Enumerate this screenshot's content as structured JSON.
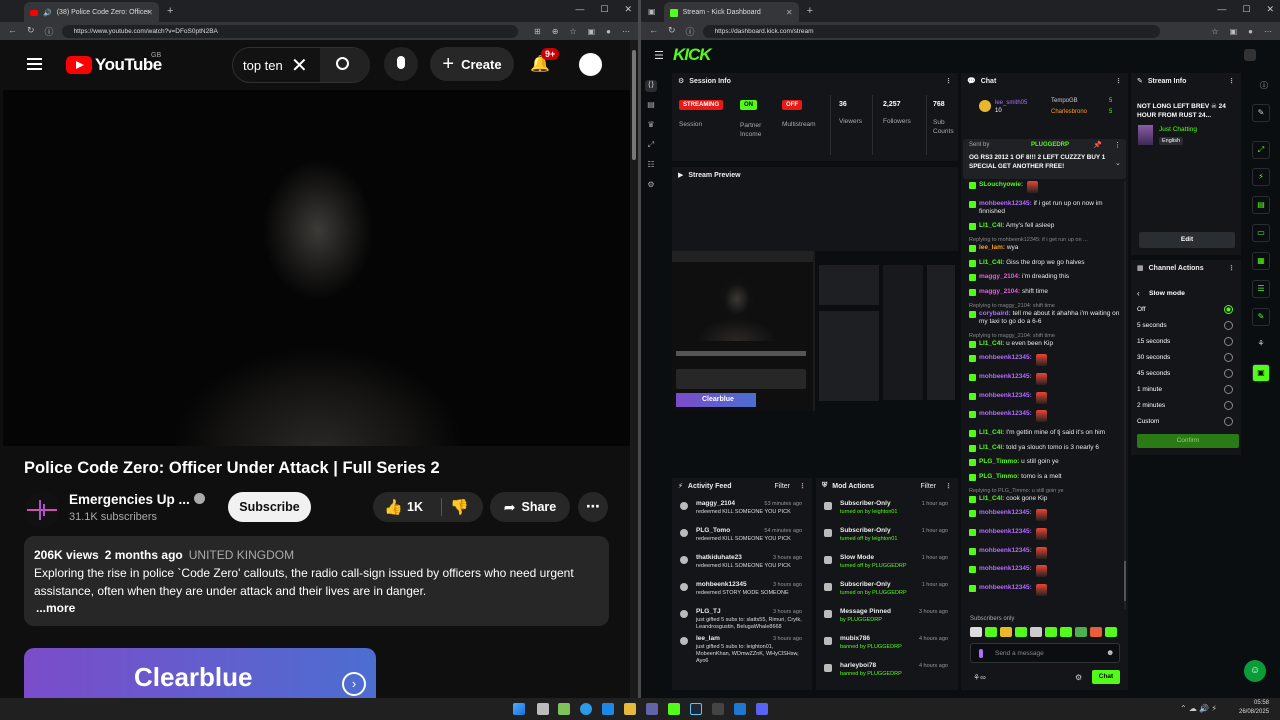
{
  "youtube_window": {
    "tab_title": "(38) Police Code Zero: Officer",
    "url": "https://www.youtube.com/watch?v=DFoS0ptN2BA",
    "logo_text": "YouTube",
    "region": "GB",
    "search_value": "top ten",
    "create_label": "Create",
    "notif_count": "9+",
    "video_title": "Police Code Zero: Officer Under Attack | Full Series 2",
    "channel_name": "Emergencies Up ...",
    "subscribers": "31.1K subscribers",
    "subscribe_label": "Subscribe",
    "likes": "1K",
    "share_label": "Share",
    "views": "206K views",
    "age": "2 months ago",
    "country": "UNITED KINGDOM",
    "desc_line1": "Exploring the rise in police `Code Zero' callouts, the radio call-sign issued by officers who need urgent",
    "desc_line2": "assistance, often when they are under attack and their lives are in danger.",
    "more_label": "...more",
    "ad_text": "Clearblue"
  },
  "kick_window": {
    "tab_title": "Stream - Kick Dashboard",
    "url": "https://dashboard.kick.com/stream",
    "logo": "KICK",
    "session": {
      "header": "Session Info",
      "streaming": "STREAMING",
      "session_label": "Session",
      "on": "ON",
      "partner_label": "Partner Income",
      "off": "OFF",
      "multistream_label": "Multistream",
      "viewers": "36",
      "viewers_label": "Viewers",
      "followers": "2,257",
      "followers_label": "Followers",
      "subs": "768",
      "subs_label": "Sub Counts"
    },
    "preview_header": "Stream Preview",
    "preview_ad": "Clearblue",
    "activity": {
      "header": "Activity Feed",
      "filter": "Filter",
      "rows": [
        {
          "name": "maggy_2104",
          "time": "53 minutes ago",
          "sub": "redeemed KILL SOMEONE YOU PICK"
        },
        {
          "name": "PLG_Tomo",
          "time": "54 minutes ago",
          "sub": "redeemed KILL SOMEONE YOU PICK"
        },
        {
          "name": "thatkiduhate23",
          "time": "3 hours ago",
          "sub": "redeemed KILL SOMEONE YOU PICK"
        },
        {
          "name": "mohbeenk12345",
          "time": "3 hours ago",
          "sub": "redeemed STORY MODE SOMEONE"
        },
        {
          "name": "PLG_TJ",
          "time": "3 hours ago",
          "sub": "just gifted 5 subs to: slatts55, Rimuri, Crytk, Leandrosgustin, BelugaWhale8668"
        },
        {
          "name": "lee_lam",
          "time": "3 hours ago",
          "sub": "just gifted 5 subs to: leighton01, MobeenKhan, WDmwZZnK, WHyClSHsw, Ayo6"
        }
      ]
    },
    "mod": {
      "header": "Mod Actions",
      "filter": "Filter",
      "rows": [
        {
          "name": "Subscriber-Only",
          "time": "1 hour ago",
          "sub": "turned on by leighton01"
        },
        {
          "name": "Subscriber-Only",
          "time": "1 hour ago",
          "sub": "turned off by leighton01"
        },
        {
          "name": "Slow Mode",
          "time": "1 hour ago",
          "sub": "turned off by PLUGGEDRP"
        },
        {
          "name": "Subscriber-Only",
          "time": "1 hour ago",
          "sub": "turned on by PLUGGEDRP"
        },
        {
          "name": "Message Pinned",
          "time": "3 hours ago",
          "sub": "by PLUGGEDRP"
        },
        {
          "name": "mubix786",
          "time": "4 hours ago",
          "sub": "banned by PLUGGEDRP"
        },
        {
          "name": "harleyboi78",
          "time": "4 hours ago",
          "sub": "banned by PLUGGEDRP"
        }
      ]
    },
    "chat": {
      "header": "Chat",
      "top_user": "lee_smith05",
      "top_count": "10",
      "top2": "TempoGB",
      "top2_count": "5",
      "top3": "Charlesbrono",
      "top3_count": "5",
      "pinned_by": "Sent by",
      "pinned_user": "PLUGGEDRP",
      "pinned_text": "OG RS3 2012 1 OF 8!!! 2 LEFT CUZZZY BUY 1 SPECIAL GET ANOTHER FREE!",
      "lines": [
        {
          "reply": "",
          "user": "SLouchyowie:",
          "color": "#53fc18",
          "text": ""
        },
        {
          "reply": "",
          "user": "mohbeenk12345:",
          "color": "#b36cff",
          "text": "if i get run up on now im finnished"
        },
        {
          "reply": "",
          "user": "LI1_C4l:",
          "color": "#53fc18",
          "text": "Amy's fell asleep"
        },
        {
          "reply": "Replying to mohbeenk12345: if i get run up on ...",
          "user": "lee_lam:",
          "color": "#ff9f1c",
          "text": "wya"
        },
        {
          "reply": "",
          "user": "LI1_C4l:",
          "color": "#53fc18",
          "text": "Giss the drop we go halves"
        },
        {
          "reply": "",
          "user": "maggy_2104:",
          "color": "#e85dd9",
          "text": "i'm dreading this"
        },
        {
          "reply": "",
          "user": "maggy_2104:",
          "color": "#e85dd9",
          "text": "shift time"
        },
        {
          "reply": "Replying to maggy_2104: shift time",
          "user": "corybaird:",
          "color": "#b36cff",
          "text": "tell me about it ahahha i'm waiting on my taxi to go do a 6-6"
        },
        {
          "reply": "Replying to maggy_2104: shift time",
          "user": "LI1_C4l:",
          "color": "#53fc18",
          "text": "u even been Kip"
        },
        {
          "reply": "",
          "user": "mohbeenk12345:",
          "color": "#b36cff",
          "text": ""
        },
        {
          "reply": "",
          "user": "mohbeenk12345:",
          "color": "#b36cff",
          "text": ""
        },
        {
          "reply": "",
          "user": "mohbeenk12345:",
          "color": "#b36cff",
          "text": ""
        },
        {
          "reply": "",
          "user": "mohbeenk12345:",
          "color": "#b36cff",
          "text": ""
        },
        {
          "reply": "",
          "user": "LI1_C4l:",
          "color": "#53fc18",
          "text": "I'm gettin mine of tj said it's on him"
        },
        {
          "reply": "",
          "user": "LI1_C4l:",
          "color": "#53fc18",
          "text": "told ya slouch tomo is 3 nearly 6"
        },
        {
          "reply": "",
          "user": "PLG_Timmo:",
          "color": "#53fc18",
          "text": "u still goin ye"
        },
        {
          "reply": "",
          "user": "PLG_Timmo:",
          "color": "#53fc18",
          "text": "tomo is a melt"
        },
        {
          "reply": "Replying to PLG_Timmo: u still goin ye",
          "user": "LI1_C4l:",
          "color": "#53fc18",
          "text": "cook gone Kip"
        },
        {
          "reply": "",
          "user": "mohbeenk12345:",
          "color": "#b36cff",
          "text": ""
        },
        {
          "reply": "",
          "user": "mohbeenk12345:",
          "color": "#b36cff",
          "text": ""
        },
        {
          "reply": "",
          "user": "mohbeenk12345:",
          "color": "#b36cff",
          "text": ""
        },
        {
          "reply": "",
          "user": "mohbeenk12345:",
          "color": "#b36cff",
          "text": ""
        },
        {
          "reply": "",
          "user": "mohbeenk12345:",
          "color": "#b36cff",
          "text": ""
        }
      ],
      "subs_only": "Subscribers only",
      "placeholder": "Send a message",
      "send": "Chat"
    },
    "stream_info": {
      "header": "Stream Info",
      "title": "NOT LONG LEFT BREV ☠ 24 HOUR FROM RUST 24...",
      "category": "Just Chatting",
      "language": "English",
      "edit": "Edit"
    },
    "channel_actions": {
      "header": "Channel Actions",
      "slow_mode": "Slow mode",
      "options": [
        "Off",
        "5 seconds",
        "15 seconds",
        "30 seconds",
        "45 seconds",
        "1 minute",
        "2 minutes",
        "Custom"
      ],
      "selected": 0,
      "confirm": "Confirm"
    }
  },
  "taskbar": {
    "time": "05:58",
    "date": "26/08/2025"
  },
  "colors": {
    "kick_green": "#53fc18",
    "yt_red": "#ff0000",
    "streaming_red": "#e91916"
  }
}
